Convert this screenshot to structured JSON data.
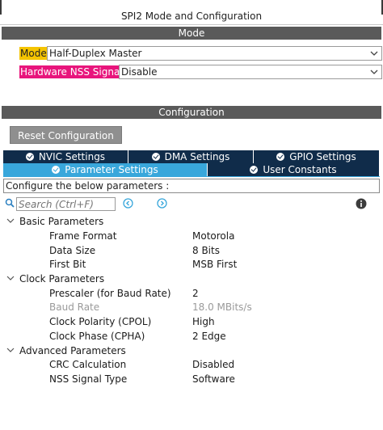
{
  "window": {
    "title": "SPI2 Mode and Configuration"
  },
  "mode_section": {
    "header": "Mode",
    "mode_label": "Mode",
    "mode_value": "Half-Duplex Master",
    "nss_label": "Hardware NSS Signal",
    "nss_value": "Disable"
  },
  "config_section": {
    "header": "Configuration",
    "reset_button": "Reset Configuration",
    "tabs": [
      {
        "label": "NVIC Settings",
        "active": false
      },
      {
        "label": "DMA Settings",
        "active": false
      },
      {
        "label": "GPIO Settings",
        "active": false
      },
      {
        "label": "Parameter Settings",
        "active": true
      },
      {
        "label": "User Constants",
        "active": false
      }
    ],
    "hint": "Configure the below parameters :",
    "search_placeholder": "Search (Ctrl+F)"
  },
  "parameters": {
    "groups": [
      {
        "name": "Basic Parameters",
        "items": [
          {
            "name": "Frame Format",
            "value": "Motorola"
          },
          {
            "name": "Data Size",
            "value": "8 Bits"
          },
          {
            "name": "First Bit",
            "value": "MSB First"
          }
        ]
      },
      {
        "name": "Clock Parameters",
        "items": [
          {
            "name": "Prescaler (for Baud Rate)",
            "value": "2"
          },
          {
            "name": "Baud Rate",
            "value": "18.0 MBits/s",
            "disabled": true
          },
          {
            "name": "Clock Polarity (CPOL)",
            "value": "High"
          },
          {
            "name": "Clock Phase (CPHA)",
            "value": "2 Edge"
          }
        ]
      },
      {
        "name": "Advanced Parameters",
        "items": [
          {
            "name": "CRC Calculation",
            "value": "Disabled"
          },
          {
            "name": "NSS Signal Type",
            "value": "Software"
          }
        ]
      }
    ]
  },
  "colors": {
    "section_bar": "#5a5a5a",
    "mode_label_bg": "#f5c400",
    "nss_label_bg": "#e8157c",
    "tab_dark": "#102c4a",
    "tab_active": "#39a7db",
    "nav_icon": "#39a7db"
  },
  "icons": {
    "search": "search-icon",
    "prev": "chevron-left-circle-icon",
    "next": "chevron-right-circle-icon",
    "info": "info-icon",
    "dropdown": "chevron-down-icon",
    "tab_check": "check-circle-icon",
    "group_caret": "caret-down-icon"
  }
}
